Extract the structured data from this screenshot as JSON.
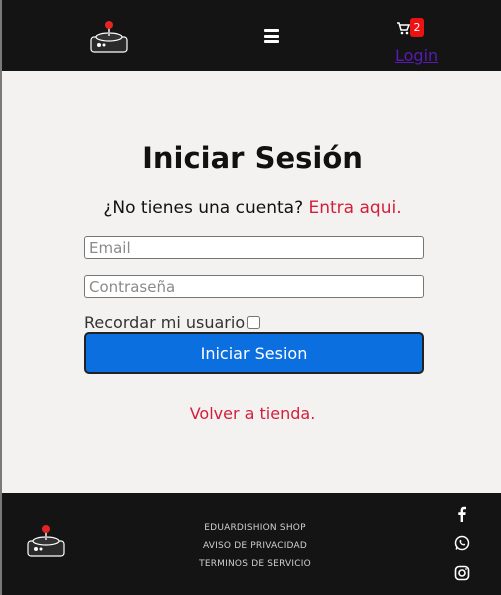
{
  "header": {
    "logo_icon": "joystick-logo-icon",
    "menu_icon": "hamburger-menu-icon",
    "cart_icon": "shopping-cart-icon",
    "cart_count": "2",
    "login_label": "Login"
  },
  "main": {
    "title": "Iniciar Sesión",
    "subtitle_text": "¿No tienes una cuenta?",
    "subtitle_link": "Entra aqui.",
    "email_placeholder": "Email",
    "password_placeholder": "Contraseña",
    "remember_label": "Recordar mi usuario",
    "submit_label": "Iniciar Sesion",
    "back_link": "Volver a tienda."
  },
  "footer": {
    "links": [
      "EDUARDISHION SHOP",
      "AVISO DE PRIVACIDAD",
      "TERMINOS DE SERVICIO"
    ],
    "social_icons": [
      "facebook-icon",
      "whatsapp-icon",
      "instagram-icon"
    ]
  },
  "colors": {
    "header_bg": "#141414",
    "accent_red": "#d41e3a",
    "button_blue": "#0c6fe0",
    "login_purple": "#5a1ab3"
  }
}
